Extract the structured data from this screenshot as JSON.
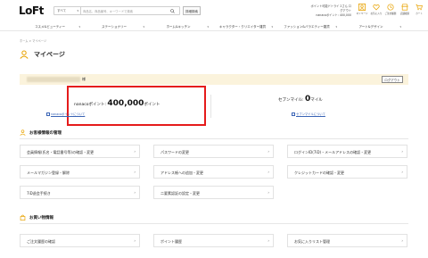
{
  "header": {
    "logo": "LoFt",
    "search_category": "すべて",
    "search_placeholder": "商品名、商品番号、キーワードで検索",
    "detail_search": "詳細検索",
    "user_line1": "ポイント可能ドトライ 2さん ログアウト",
    "user_line2": "nanacoポイント: 400,000",
    "icons": [
      {
        "name": "mypage-icon",
        "label": "マイページ"
      },
      {
        "name": "favorite-icon",
        "label": "お気に入り"
      },
      {
        "name": "history-icon",
        "label": "ご注文履歴"
      },
      {
        "name": "shop-icon",
        "label": "店舗検索"
      },
      {
        "name": "cart-icon",
        "label": "カート"
      }
    ],
    "accent_color": "#e8a200"
  },
  "nav": [
    "コスメ&ビューティー",
    "ステーショナリー",
    "ホーム&キッチン",
    "キャラクター・クリエイター雑貨",
    "ファッション&バラエティー雑貨",
    "アート&デザイン"
  ],
  "breadcrumb": "ホーム > マイページ",
  "page_title": "マイページ",
  "member": {
    "name_suffix": "様",
    "logout": "ログアウト"
  },
  "points": {
    "nanaco_label": "nanacoポイント: ",
    "nanaco_value": "400,000",
    "nanaco_unit": "ポイント",
    "nanaco_link": "nanacoポイントについて",
    "seven_label": "セブンマイル: ",
    "seven_value": "0",
    "seven_unit": "マイル",
    "seven_link": "セブンマイルについて",
    "highlight_color": "#e51b1b"
  },
  "sections": {
    "account_title": "お客様情報の管理",
    "shopping_title": "お買い物情報"
  },
  "account_cards": [
    "会員情報(氏名・電話番号等)の確認・変更",
    "パスワードの変更",
    "ログインID(7iD)・メールアドレスの確認・変更",
    "メールマガジン登録・解除",
    "アドレス帳への追加・変更",
    "クレジットカードの確認・変更",
    "7iD退会手続き",
    "二要素認証の設定・変更"
  ],
  "shopping_cards": [
    "ご注文履歴の確認",
    "ポイント履歴",
    "お気に入りリスト管理"
  ]
}
